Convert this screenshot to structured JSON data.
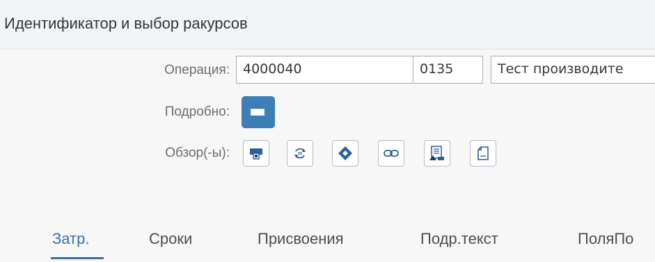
{
  "header": {
    "title": "Идентификатор и выбор ракурсов"
  },
  "operation": {
    "label": "Операция:",
    "number": "4000040",
    "code": "0135",
    "description": "Тест производите"
  },
  "detail": {
    "label": "Подробно:"
  },
  "overviews": {
    "label": "Обзор(-ы):",
    "icons": [
      "printer-icon",
      "refresh-icon",
      "diamond-icon",
      "link-icon",
      "document-transfer-icon",
      "document-icon"
    ]
  },
  "tabs": [
    {
      "label": "Затр.",
      "active": true
    },
    {
      "label": "Сроки",
      "active": false
    },
    {
      "label": "Присвоения",
      "active": false
    },
    {
      "label": "Подр.текст",
      "active": false
    },
    {
      "label": "ПоляПо",
      "active": false
    }
  ],
  "colors": {
    "accent": "#3a6fa6",
    "button": "#3c7fb6"
  }
}
